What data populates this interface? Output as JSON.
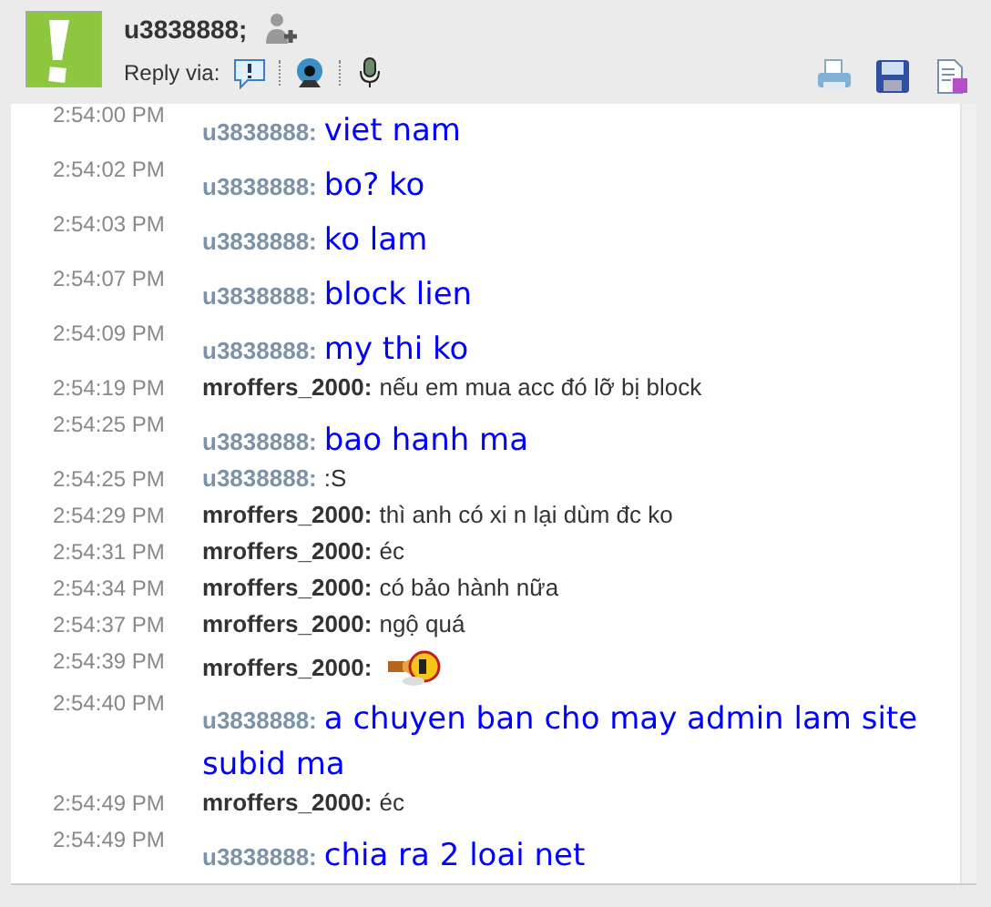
{
  "header": {
    "username": "u3838888;",
    "reply_label": "Reply via:"
  },
  "messages": [
    {
      "time": "2:54:00 PM",
      "sender": "u3838888:",
      "outgoing": false,
      "kind": "big",
      "text": "viet nam"
    },
    {
      "time": "2:54:02 PM",
      "sender": "u3838888:",
      "outgoing": false,
      "kind": "big",
      "text": "bo? ko"
    },
    {
      "time": "2:54:03 PM",
      "sender": "u3838888:",
      "outgoing": false,
      "kind": "big",
      "text": "ko lam"
    },
    {
      "time": "2:54:07 PM",
      "sender": "u3838888:",
      "outgoing": false,
      "kind": "big",
      "text": "block lien"
    },
    {
      "time": "2:54:09 PM",
      "sender": "u3838888:",
      "outgoing": false,
      "kind": "big",
      "text": "my thi ko"
    },
    {
      "time": "2:54:19 PM",
      "sender": "mroffers_2000:",
      "outgoing": true,
      "kind": "small",
      "text": "nếu em mua acc đó lỡ bị block"
    },
    {
      "time": "2:54:25 PM",
      "sender": "u3838888:",
      "outgoing": false,
      "kind": "big",
      "text": "bao hanh ma"
    },
    {
      "time": "2:54:25 PM",
      "sender": "u3838888:",
      "outgoing": false,
      "kind": "small",
      "text": ":S"
    },
    {
      "time": "2:54:29 PM",
      "sender": "mroffers_2000:",
      "outgoing": true,
      "kind": "small",
      "text": "thì anh có xi n lại dùm đc ko"
    },
    {
      "time": "2:54:31 PM",
      "sender": "mroffers_2000:",
      "outgoing": true,
      "kind": "small",
      "text": "éc"
    },
    {
      "time": "2:54:34 PM",
      "sender": "mroffers_2000:",
      "outgoing": true,
      "kind": "small",
      "text": "có bảo hành nữa"
    },
    {
      "time": "2:54:37 PM",
      "sender": "mroffers_2000:",
      "outgoing": true,
      "kind": "small",
      "text": "ngộ quá"
    },
    {
      "time": "2:54:39 PM",
      "sender": "mroffers_2000:",
      "outgoing": true,
      "kind": "emoticon"
    },
    {
      "time": "2:54:40 PM",
      "sender": "u3838888:",
      "outgoing": false,
      "kind": "big",
      "text": "a chuyen ban cho may admin lam site subid ma"
    },
    {
      "time": "2:54:49 PM",
      "sender": "mroffers_2000:",
      "outgoing": true,
      "kind": "small",
      "text": "éc"
    },
    {
      "time": "2:54:49 PM",
      "sender": "u3838888:",
      "outgoing": false,
      "kind": "big",
      "text": "chia ra 2 loai net"
    }
  ]
}
